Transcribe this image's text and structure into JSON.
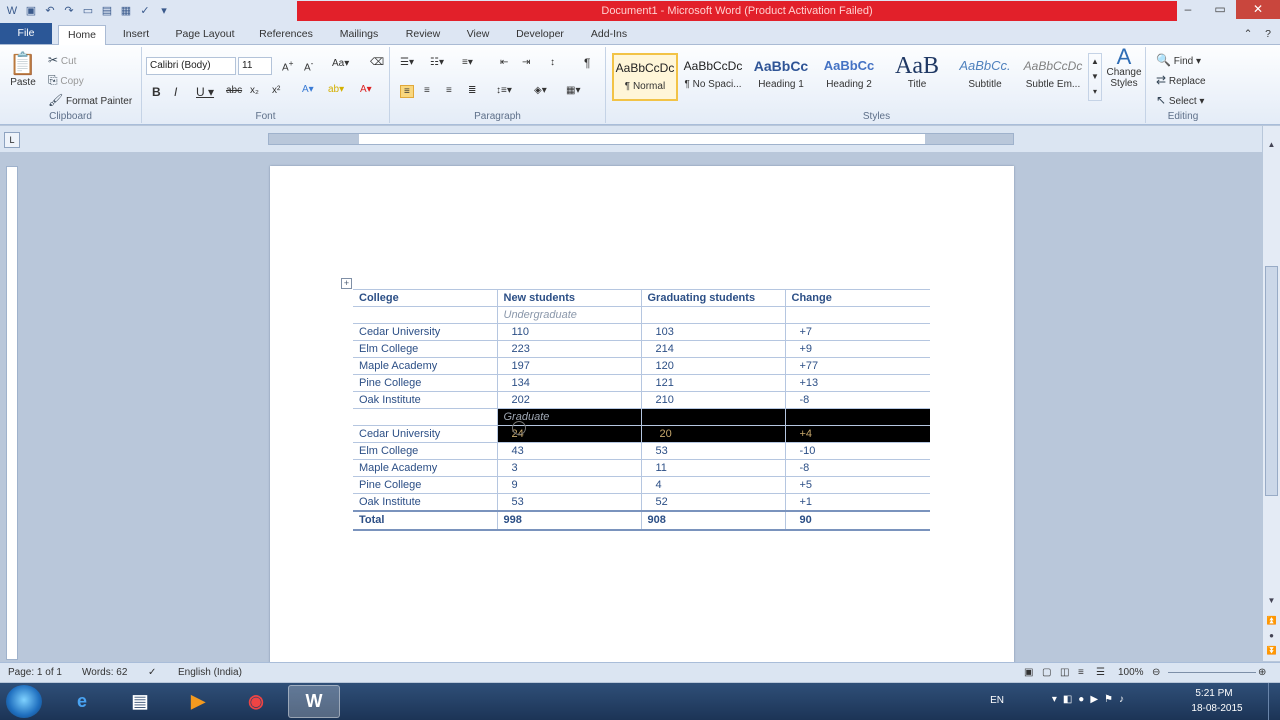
{
  "window": {
    "title": "Document1  -  Microsoft Word (Product Activation Failed)"
  },
  "tabs": [
    "File",
    "Home",
    "Insert",
    "Page Layout",
    "References",
    "Mailings",
    "Review",
    "View",
    "Developer",
    "Add-Ins"
  ],
  "ribbon": {
    "clipboard": {
      "paste": "Paste",
      "cut": "Cut",
      "copy": "Copy",
      "format_painter": "Format Painter",
      "label": "Clipboard"
    },
    "font": {
      "name": "Calibri (Body)",
      "size": "11",
      "label": "Font"
    },
    "paragraph": {
      "label": "Paragraph"
    },
    "styles": {
      "label": "Styles",
      "items": [
        {
          "sample": "AaBbCcDc",
          "name": "¶ Normal"
        },
        {
          "sample": "AaBbCcDc",
          "name": "¶ No Spaci..."
        },
        {
          "sample": "AaBbCc",
          "name": "Heading 1"
        },
        {
          "sample": "AaBbCc",
          "name": "Heading 2"
        },
        {
          "sample": "AaB",
          "name": "Title"
        },
        {
          "sample": "AaBbCc.",
          "name": "Subtitle"
        },
        {
          "sample": "AaBbCcDc",
          "name": "Subtle Em..."
        }
      ],
      "change_styles": "Change Styles"
    },
    "editing": {
      "find": "Find",
      "replace": "Replace",
      "select": "Select",
      "label": "Editing"
    }
  },
  "table": {
    "headers": [
      "College",
      "New students",
      "Graduating students",
      "Change"
    ],
    "undergrad_label": "Undergraduate",
    "undergrad_rows": [
      [
        "Cedar University",
        "110",
        "103",
        "+7"
      ],
      [
        "Elm College",
        "223",
        "214",
        "+9"
      ],
      [
        "Maple Academy",
        "197",
        "120",
        "+77"
      ],
      [
        "Pine College",
        "134",
        "121",
        "+13"
      ],
      [
        "Oak Institute",
        "202",
        "210",
        "-8"
      ]
    ],
    "grad_label": "Graduate",
    "grad_rows": [
      [
        "Cedar University",
        "24",
        "20",
        "+4"
      ],
      [
        "Elm College",
        "43",
        "53",
        "-10"
      ],
      [
        "Maple Academy",
        "3",
        "11",
        "-8"
      ],
      [
        "Pine College",
        "9",
        "4",
        "+5"
      ],
      [
        "Oak Institute",
        "53",
        "52",
        "+1"
      ]
    ],
    "total": [
      "Total",
      "998",
      "908",
      "90"
    ]
  },
  "status": {
    "page": "Page: 1 of 1",
    "words": "Words: 62",
    "language": "English (India)",
    "zoom": "100%"
  },
  "taskbar": {
    "lang": "EN",
    "time": "5:21 PM",
    "date": "18-08-2015"
  }
}
